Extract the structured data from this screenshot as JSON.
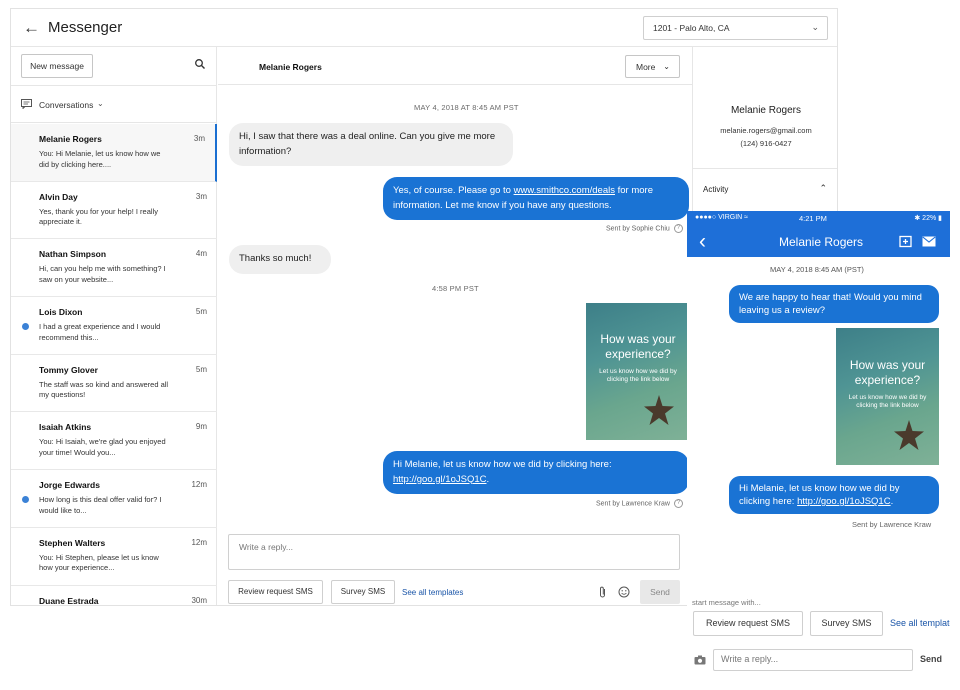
{
  "header": {
    "title": "Messenger",
    "location": "1201 - Palo Alto, CA"
  },
  "sidebar": {
    "new_message_label": "New message",
    "conversations_label": "Conversations",
    "items": [
      {
        "name": "Melanie Rogers",
        "time": "3m",
        "preview": "You: Hi Melanie, let us know how we did by clicking here....",
        "unread": false
      },
      {
        "name": "Alvin Day",
        "time": "3m",
        "preview": "Yes, thank you for your help! I really appreciate it.",
        "unread": false
      },
      {
        "name": "Nathan Simpson",
        "time": "4m",
        "preview": "Hi, can you help me with something? I saw on your website...",
        "unread": false
      },
      {
        "name": "Lois Dixon",
        "time": "5m",
        "preview": "I had a great experience and I would recommend this...",
        "unread": true
      },
      {
        "name": "Tommy Glover",
        "time": "5m",
        "preview": "The staff was so kind and answered all my questions!",
        "unread": false
      },
      {
        "name": "Isaiah Atkins",
        "time": "9m",
        "preview": "You: Hi Isaiah, we're glad you enjoyed your time! Would you...",
        "unread": false
      },
      {
        "name": "Jorge Edwards",
        "time": "12m",
        "preview": "How long is this deal offer valid for? I would like to...",
        "unread": true
      },
      {
        "name": "Stephen Walters",
        "time": "12m",
        "preview": "You: Hi Stephen, please let us know how your experience...",
        "unread": false
      },
      {
        "name": "Duane Estrada",
        "time": "30m",
        "preview": "",
        "unread": false
      }
    ]
  },
  "chat": {
    "contact_name": "Melanie Rogers",
    "more_label": "More",
    "date1": "MAY 4, 2018 AT 8:45 AM PST",
    "msg1": "Hi, I saw that there was a deal online. Can you give me more information?",
    "msg2_pre": "Yes, of course. Please go to ",
    "msg2_link": "www.smithco.com/deals",
    "msg2_post": " for more information. Let me know if you have any questions.",
    "sent_by1": "Sent by Sophie Chiu",
    "msg3": "Thanks so much!",
    "date2": "4:58 PM PST",
    "card_title": "How was your experience?",
    "card_sub": "Let us know how we did by clicking the link below",
    "msg4_pre": "Hi Melanie, let us know how we did by clicking here: ",
    "msg4_link": "http://goo.gl/1oJSQ1C",
    "msg4_post": ".",
    "sent_by2": "Sent by Lawrence Kraw",
    "reply_placeholder": "Write a reply...",
    "template1": "Review request SMS",
    "template2": "Survey SMS",
    "see_all": "See all templates",
    "send_label": "Send"
  },
  "contact_panel": {
    "name": "Melanie Rogers",
    "email": "melanie.rogers@gmail.com",
    "phone": "(124) 916-0427",
    "activity_label": "Activity"
  },
  "mobile": {
    "carrier": "●●●●○ VIRGIN",
    "clock": "4:21 PM",
    "battery": "22%",
    "title": "Melanie Rogers",
    "date": "MAY 4, 2018  8:45 AM (PST)",
    "msg1": "We are happy to hear that! Would you mind leaving us a review?",
    "card_title": "How was your experience?",
    "card_sub": "Let us know how we did by clicking the link below",
    "msg2_pre": "Hi Melanie, let us know how we did by clicking here: ",
    "msg2_link": "http://goo.gl/1oJSQ1C",
    "msg2_post": ".",
    "sent_by": "Sent by Lawrence Kraw",
    "start_with": "start message with...",
    "template1": "Review request SMS",
    "template2": "Survey SMS",
    "see_all": "See all templates",
    "reply_placeholder": "Write a reply...",
    "send_label": "Send"
  },
  "colors": {
    "accent": "#1a73d4",
    "mobile_bar": "#1e6fd8",
    "unread_dot": "#3b82d6"
  }
}
